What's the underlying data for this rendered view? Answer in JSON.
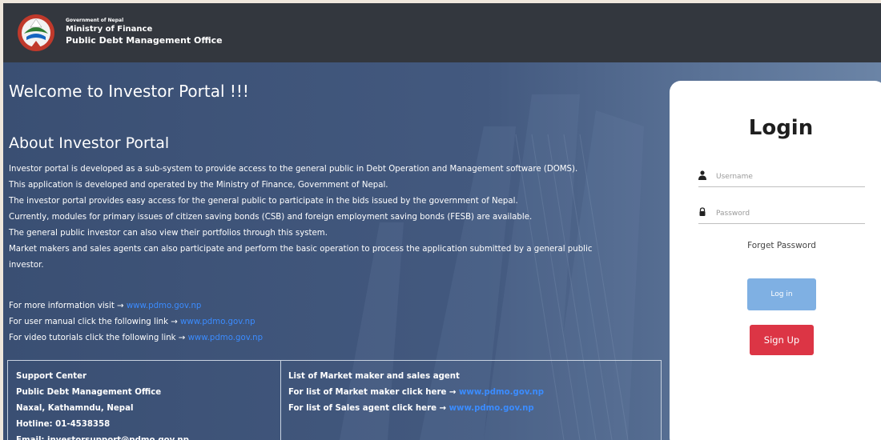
{
  "header": {
    "gov_line": "Government of Nepal",
    "ministry": "Ministry of Finance",
    "office": "Public Debt Management Office"
  },
  "hero": {
    "welcome": "Welcome to Investor Portal !!!",
    "about_title": "About Investor Portal",
    "about_lines": [
      "Investor portal is developed as a sub-system to provide access to the general public in Debt Operation and Management software (DOMS).",
      "This application is developed and operated by the Ministry of Finance, Government of Nepal.",
      "The investor portal provides easy access for the general public to participate in the bids issued by the government of Nepal.",
      "Currently, modules for primary issues of citizen saving bonds (CSB) and foreign employment saving bonds (FESB) are available.",
      "The general public investor can also view their portfolios through this system.",
      "Market makers and sales agents can also participate and perform the basic operation to process the application submitted by a general public",
      "investor."
    ],
    "links": [
      {
        "text": "For more information visit → ",
        "url_text": "www.pdmo.gov.np"
      },
      {
        "text": "For user manual click the following link → ",
        "url_text": "www.pdmo.gov.np"
      },
      {
        "text": "For video tutorials click the following link → ",
        "url_text": "www.pdmo.gov.np"
      }
    ]
  },
  "support": {
    "title": "Support Center",
    "office": "Public Debt Management Office",
    "address": "Naxal, Kathamndu, Nepal",
    "hotline": "Hotline: 01-4538358",
    "email": "Email: investorsupport@pdmo.gov.np"
  },
  "market": {
    "title": "List of Market maker and sales agent",
    "maker_text": "For list of Market maker click here → ",
    "maker_url": "www.pdmo.gov.np",
    "agent_text": "For list of Sales agent click here → ",
    "agent_url": "www.pdmo.gov.np"
  },
  "login": {
    "title": "Login",
    "username_placeholder": "Username",
    "password_placeholder": "Password",
    "forget": "Forget Password",
    "login_button": "Log in",
    "signup_button": "Sign Up"
  },
  "colors": {
    "header_bg": "#33373e",
    "hero_bg": "#3d5479",
    "link": "#3b8cff",
    "login_button": "#7fb0e3",
    "signup_button": "#dc3545"
  },
  "icons": {
    "logo": "nepal-emblem-icon",
    "username": "user-icon",
    "password": "lock-icon"
  }
}
